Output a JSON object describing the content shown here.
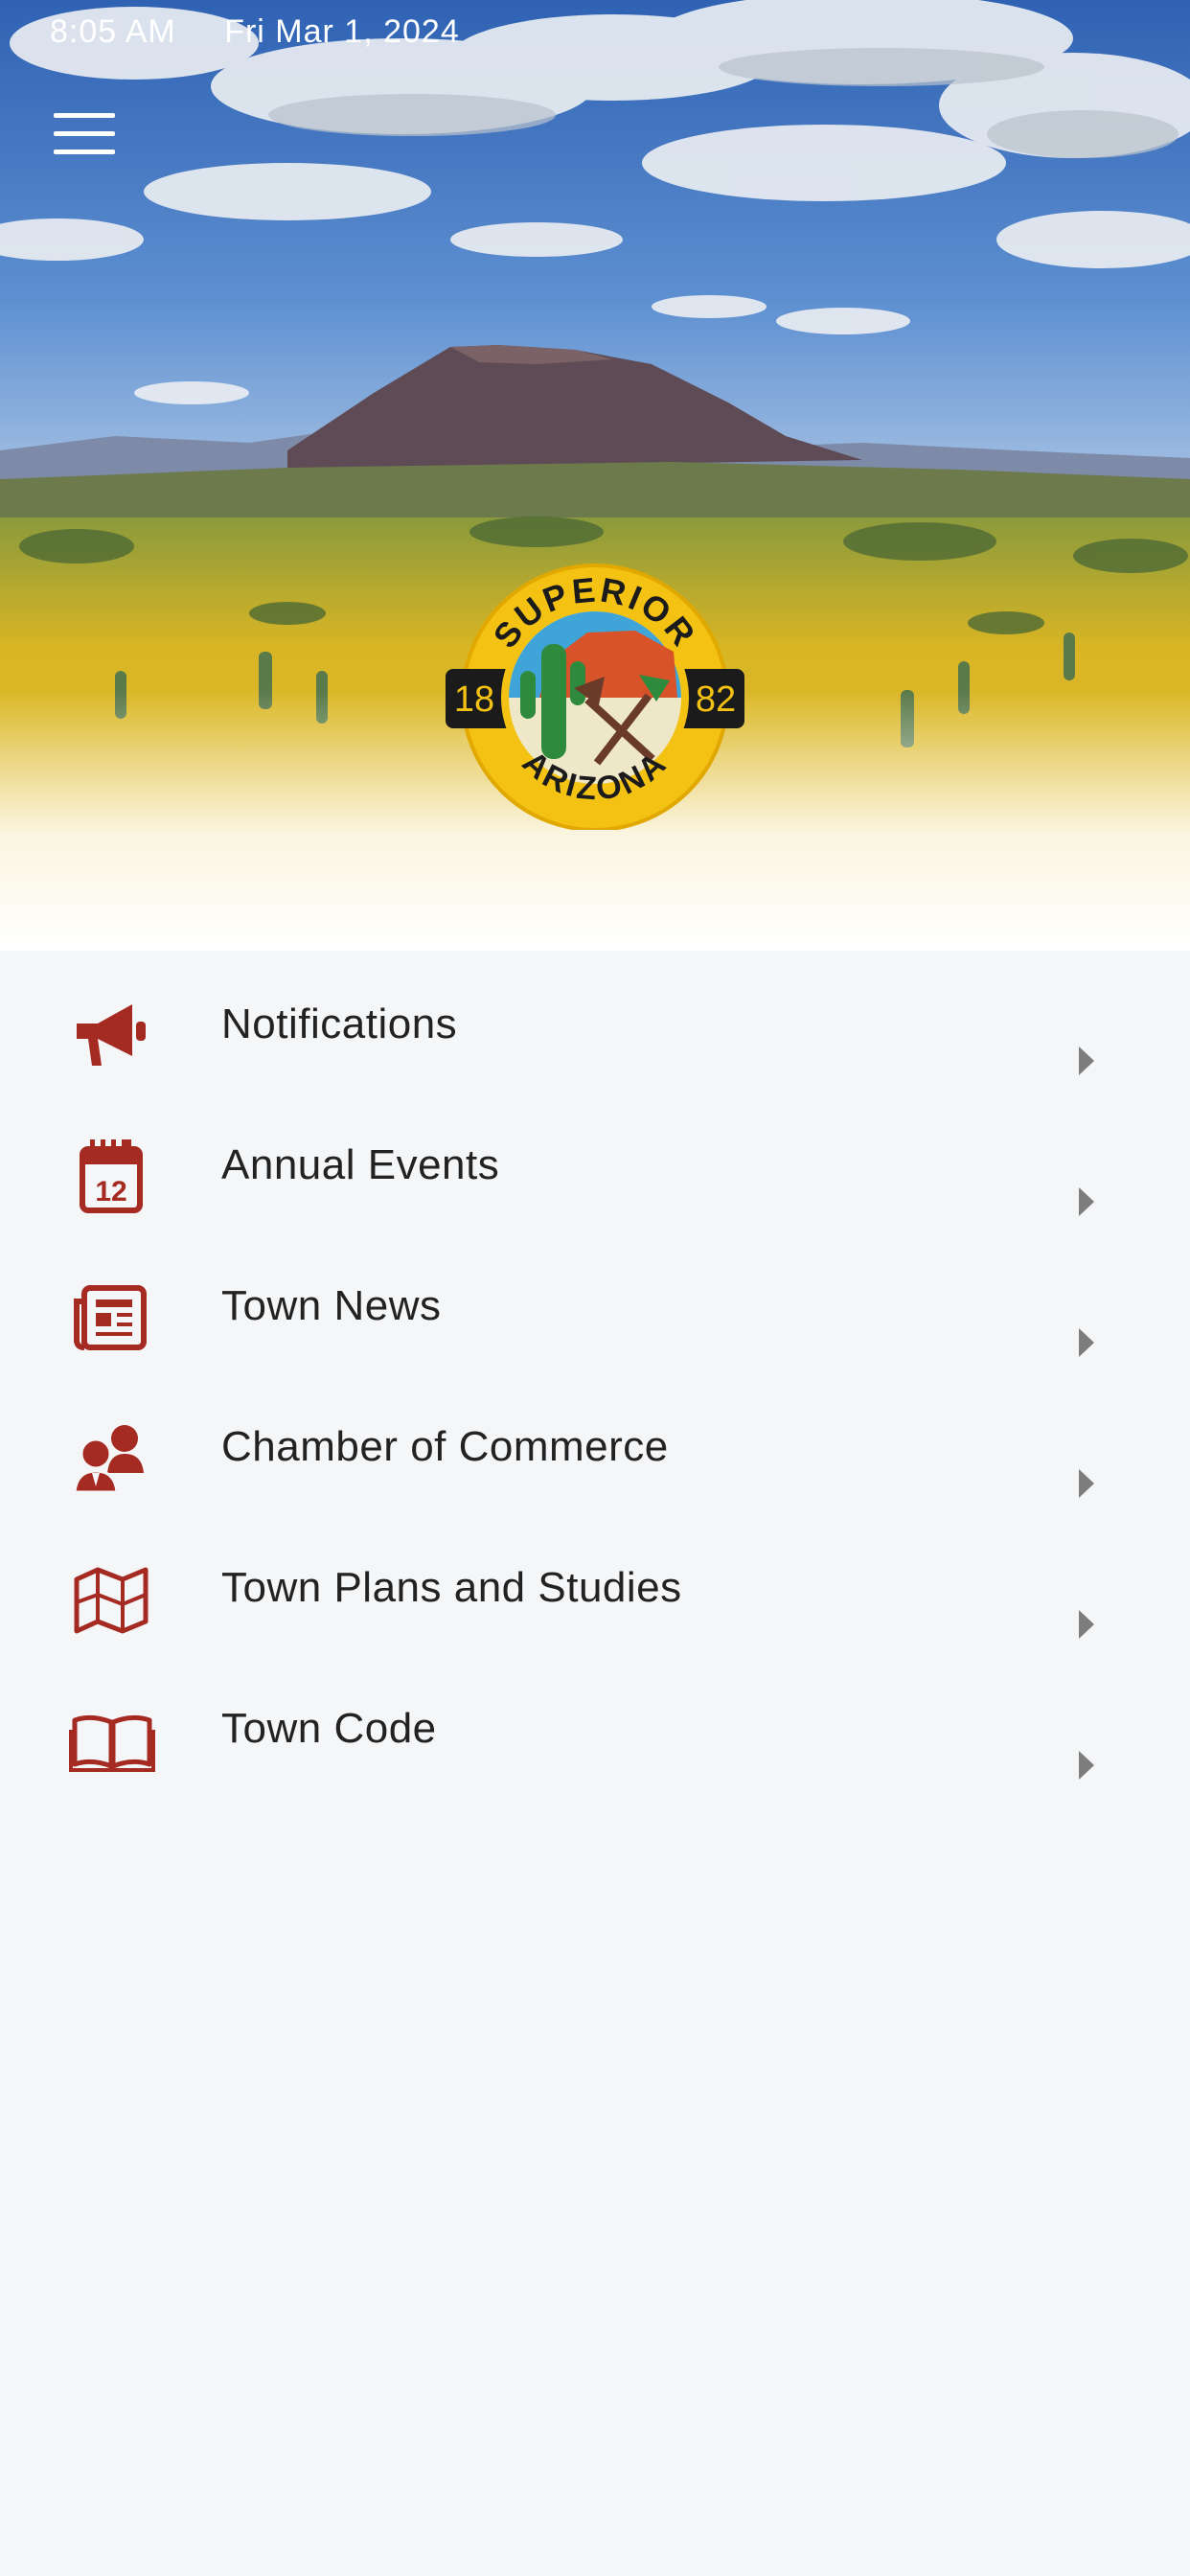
{
  "status_bar": {
    "time": "8:05 AM",
    "date": "Fri Mar 1, 2024"
  },
  "header": {
    "menu_icon": "hamburger-menu-icon",
    "seal": {
      "top_text": "SUPERIOR",
      "bottom_text": "ARIZONA",
      "year_left": "18",
      "year_right": "82"
    }
  },
  "colors": {
    "accent": "#a52a22",
    "chevron": "#7d7d7d",
    "background": "#f5f6f8",
    "seal_gold": "#f3c212"
  },
  "menu": {
    "items": [
      {
        "label": "Notifications",
        "icon": "megaphone-icon"
      },
      {
        "label": "Annual Events",
        "icon": "calendar-icon"
      },
      {
        "label": "Town News",
        "icon": "newspaper-icon"
      },
      {
        "label": "Chamber of Commerce",
        "icon": "business-people-icon"
      },
      {
        "label": "Town Plans and Studies",
        "icon": "map-icon"
      },
      {
        "label": "Town Code",
        "icon": "open-book-icon"
      }
    ]
  }
}
